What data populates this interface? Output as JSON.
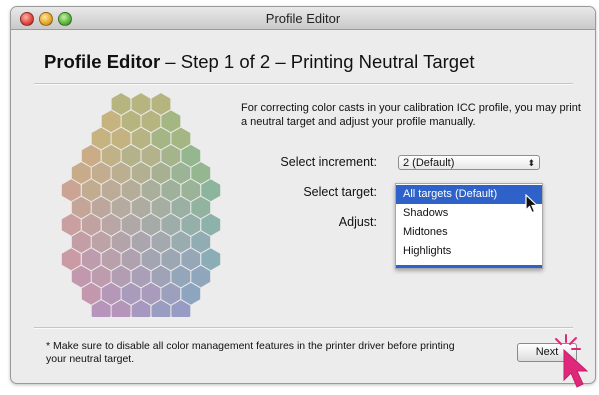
{
  "window": {
    "title": "Profile Editor"
  },
  "heading": {
    "bold": "Profile Editor",
    "rest": " – Step 1 of 2 – Printing Neutral Target"
  },
  "intro_text": "For correcting color casts in your calibration ICC profile, you may print a neutral target and adjust your profile manually.",
  "form": {
    "increment_label": "Select increment:",
    "increment_value": "2 (Default)",
    "target_label": "Select target:",
    "adjust_label": "Adjust:"
  },
  "target_menu": {
    "items": [
      "All targets (Default)",
      "Shadows",
      "Midtones",
      "Highlights"
    ],
    "selected_index": 0
  },
  "note": "* Make sure to disable all color management features in the printer driver before printing your neutral target.",
  "next_label": "Next",
  "colors": {
    "selection": "#2e62c8",
    "pointer": "#e0287a"
  },
  "icons": [
    "close-icon",
    "minimize-icon",
    "zoom-icon",
    "popup-arrows-icon",
    "mouse-pointer-icon",
    "click-pointer-icon"
  ]
}
